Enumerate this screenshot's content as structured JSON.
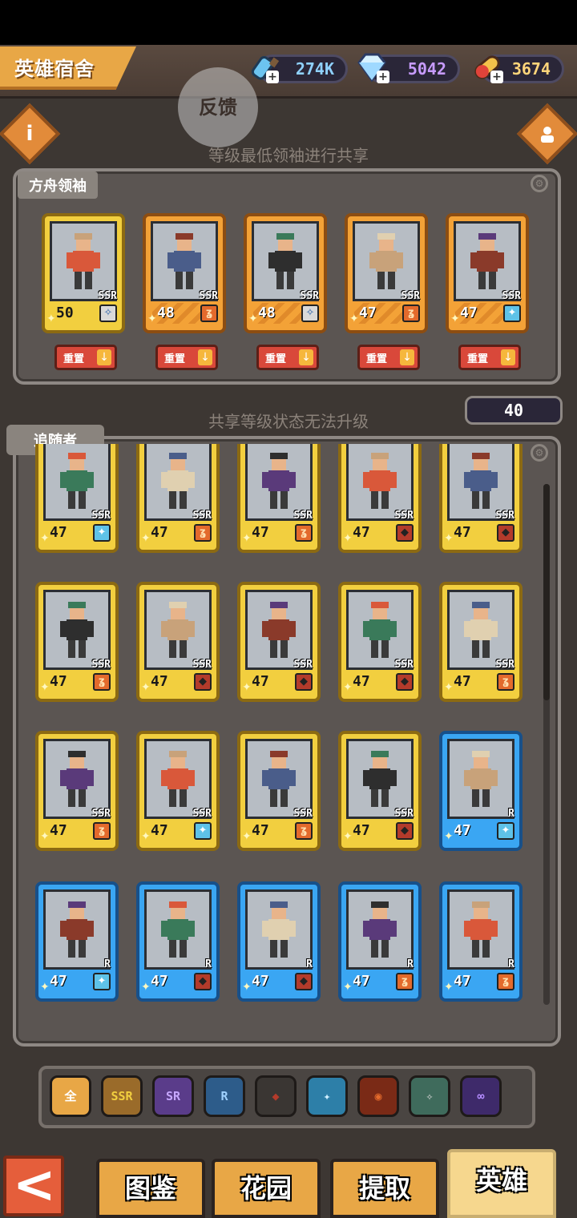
{
  "header": {
    "title": "英雄宿舍",
    "resources": [
      {
        "icon": "potion-icon",
        "value": "274K",
        "color": "#8fd1ff"
      },
      {
        "icon": "diamond-icon",
        "value": "5042",
        "color": "#c79bff"
      },
      {
        "icon": "pill-icon",
        "value": "3674",
        "color": "#ffd57a"
      }
    ]
  },
  "feedback_label": "反馈",
  "leaders_hint": "等级最低领袖进行共享",
  "leaders": {
    "label": "方舟领袖",
    "reset_label": "重置",
    "cards": [
      {
        "level": "50",
        "rarity": "SSR",
        "frame": "gold",
        "class": "wing"
      },
      {
        "level": "48",
        "rarity": "SSR",
        "frame": "orange",
        "class": "fire"
      },
      {
        "level": "48",
        "rarity": "SSR",
        "frame": "orange",
        "class": "wing"
      },
      {
        "level": "47",
        "rarity": "SSR",
        "frame": "orange",
        "class": "fire"
      },
      {
        "level": "47",
        "rarity": "SSR",
        "frame": "orange",
        "class": "beast"
      }
    ]
  },
  "shared_hint": "共享等级状态无法升级",
  "shared_level": "40",
  "followers": {
    "label": "追随者",
    "cards": [
      {
        "level": "47",
        "rarity": "SSR",
        "frame": "gold",
        "class": "beast"
      },
      {
        "level": "47",
        "rarity": "SSR",
        "frame": "gold",
        "class": "fire"
      },
      {
        "level": "47",
        "rarity": "SSR",
        "frame": "gold",
        "class": "fire"
      },
      {
        "level": "47",
        "rarity": "SSR",
        "frame": "gold",
        "class": "shield"
      },
      {
        "level": "47",
        "rarity": "SSR",
        "frame": "gold",
        "class": "shield"
      },
      {
        "level": "47",
        "rarity": "SSR",
        "frame": "gold",
        "class": "fire"
      },
      {
        "level": "47",
        "rarity": "SSR",
        "frame": "gold",
        "class": "shield"
      },
      {
        "level": "47",
        "rarity": "SSR",
        "frame": "gold",
        "class": "shield"
      },
      {
        "level": "47",
        "rarity": "SSR",
        "frame": "gold",
        "class": "shield"
      },
      {
        "level": "47",
        "rarity": "SSR",
        "frame": "gold",
        "class": "fire"
      },
      {
        "level": "47",
        "rarity": "SSR",
        "frame": "gold",
        "class": "fire"
      },
      {
        "level": "47",
        "rarity": "SSR",
        "frame": "gold",
        "class": "beast"
      },
      {
        "level": "47",
        "rarity": "SSR",
        "frame": "gold",
        "class": "fire"
      },
      {
        "level": "47",
        "rarity": "SSR",
        "frame": "gold",
        "class": "shield"
      },
      {
        "level": "47",
        "rarity": "R",
        "frame": "blue",
        "class": "beast"
      },
      {
        "level": "47",
        "rarity": "R",
        "frame": "blue",
        "class": "beast"
      },
      {
        "level": "47",
        "rarity": "R",
        "frame": "blue",
        "class": "shield"
      },
      {
        "level": "47",
        "rarity": "R",
        "frame": "blue",
        "class": "shield"
      },
      {
        "level": "47",
        "rarity": "R",
        "frame": "blue",
        "class": "fire"
      },
      {
        "level": "47",
        "rarity": "R",
        "frame": "blue",
        "class": "fire"
      }
    ]
  },
  "filters": [
    {
      "name": "filter-all",
      "label": "全",
      "bg": "#e8a746",
      "fg": "#fff"
    },
    {
      "name": "filter-ssr",
      "label": "SSR",
      "bg": "#9a6b2a",
      "fg": "#f2cf3f"
    },
    {
      "name": "filter-sr",
      "label": "SR",
      "bg": "#5a3c8a",
      "fg": "#c6a7ff"
    },
    {
      "name": "filter-r",
      "label": "R",
      "bg": "#2d5c8a",
      "fg": "#9fd1ff"
    },
    {
      "name": "filter-shield",
      "label": "◆",
      "bg": "#3a3633",
      "fg": "#b33b2b"
    },
    {
      "name": "filter-beast",
      "label": "✦",
      "bg": "#2d7fa8",
      "fg": "#cfefff"
    },
    {
      "name": "filter-fire",
      "label": "◉",
      "bg": "#7a2a16",
      "fg": "#e36a2c"
    },
    {
      "name": "filter-wing",
      "label": "✧",
      "bg": "#3f6b5c",
      "fg": "#d9d9d9"
    },
    {
      "name": "filter-infinity",
      "label": "∞",
      "bg": "#3e2a6a",
      "fg": "#b48cff"
    }
  ],
  "tabs": [
    {
      "name": "tab-codex",
      "label": "图鉴",
      "active": false
    },
    {
      "name": "tab-garden",
      "label": "花园",
      "active": false
    },
    {
      "name": "tab-extract",
      "label": "提取",
      "active": false
    },
    {
      "name": "tab-heroes",
      "label": "英雄",
      "active": true
    }
  ],
  "back_label": "<"
}
